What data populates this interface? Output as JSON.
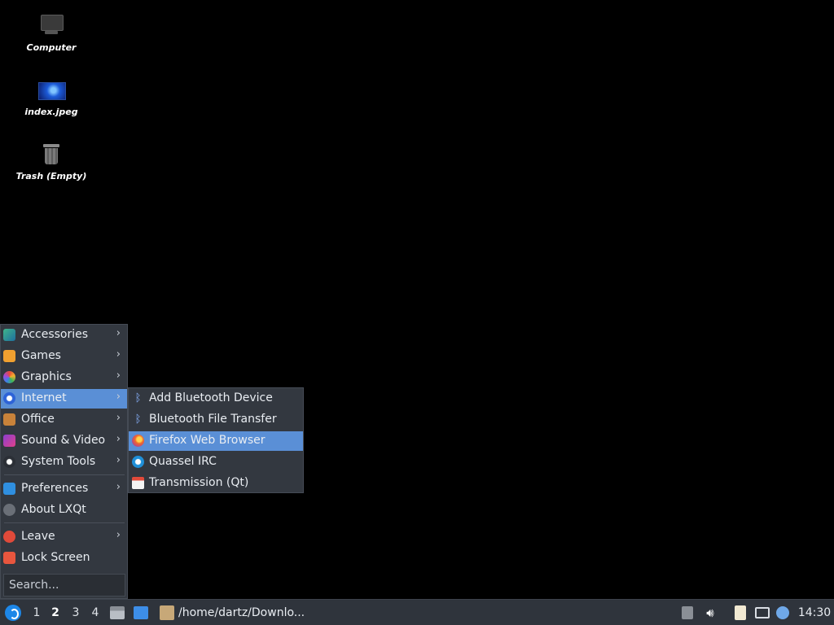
{
  "desktop": {
    "icons": [
      {
        "label": "Computer",
        "icon": "computer-icon"
      },
      {
        "label": "index.jpeg",
        "icon": "image-file-icon"
      },
      {
        "label": "Trash (Empty)",
        "icon": "trash-icon"
      }
    ]
  },
  "menu": {
    "items": [
      {
        "label": "Accessories",
        "icon": "accessories-icon",
        "submenu": true
      },
      {
        "label": "Games",
        "icon": "games-icon",
        "submenu": true
      },
      {
        "label": "Graphics",
        "icon": "graphics-icon",
        "submenu": true
      },
      {
        "label": "Internet",
        "icon": "internet-icon",
        "submenu": true,
        "active": true
      },
      {
        "label": "Office",
        "icon": "office-icon",
        "submenu": true
      },
      {
        "label": "Sound & Video",
        "icon": "sound-video-icon",
        "submenu": true
      },
      {
        "label": "System Tools",
        "icon": "system-tools-icon",
        "submenu": true
      },
      {
        "label": "Preferences",
        "icon": "preferences-icon",
        "submenu": true
      },
      {
        "label": "About LXQt",
        "icon": "info-icon",
        "submenu": false
      },
      {
        "label": "Leave",
        "icon": "power-icon",
        "submenu": true
      },
      {
        "label": "Lock Screen",
        "icon": "lock-icon",
        "submenu": false
      }
    ],
    "arrow": "›",
    "search_placeholder": "Search..."
  },
  "submenu": {
    "items": [
      {
        "label": "Add Bluetooth Device",
        "icon": "bluetooth-icon"
      },
      {
        "label": "Bluetooth File Transfer",
        "icon": "bluetooth-icon"
      },
      {
        "label": "Firefox Web Browser",
        "icon": "firefox-icon",
        "active": true
      },
      {
        "label": "Quassel IRC",
        "icon": "quassel-icon"
      },
      {
        "label": "Transmission (Qt)",
        "icon": "transmission-icon"
      }
    ]
  },
  "taskbar": {
    "desktops": [
      "1",
      "2",
      "3",
      "4"
    ],
    "active_desktop": "2",
    "task_title": "/home/dartz/Downlo...",
    "clock": "14:30"
  },
  "colors": {
    "highlight": "#5a8fd6",
    "menu_bg": "#333840",
    "panel_bg": "#2f343c"
  }
}
